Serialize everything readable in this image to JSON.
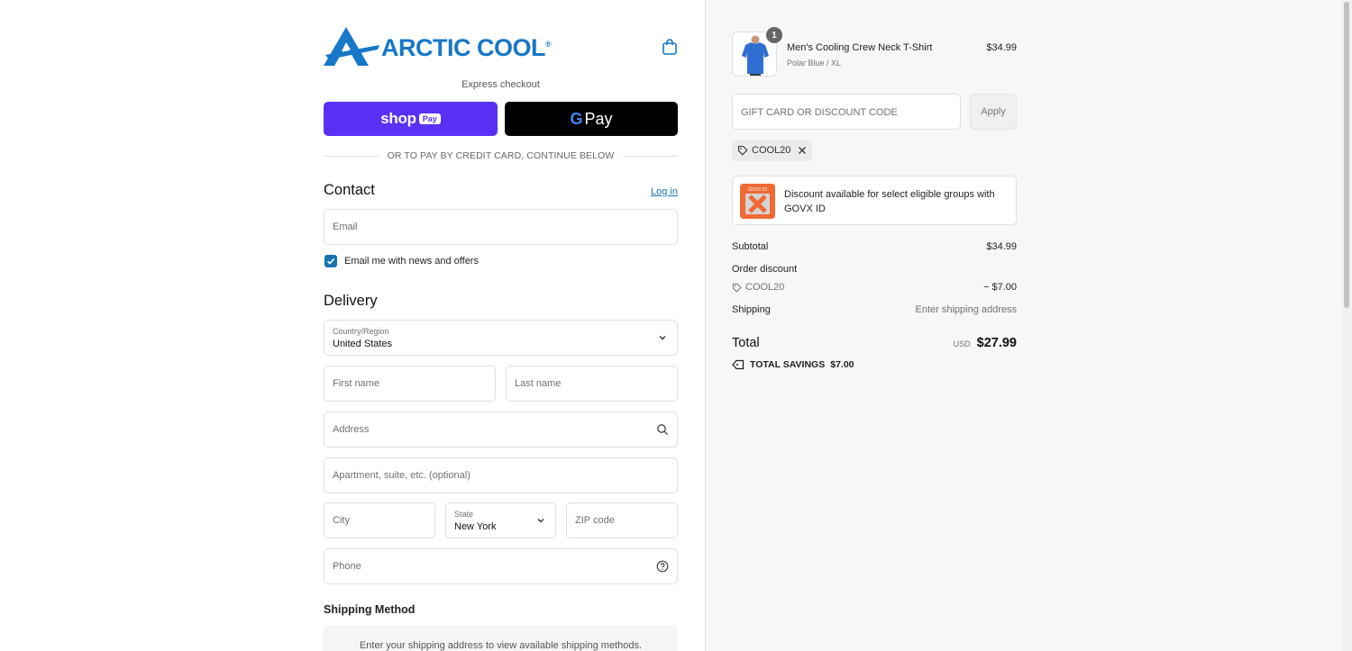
{
  "brand": {
    "name": "ARCTIC COOL",
    "reg": "®",
    "color": "#1777c8"
  },
  "express": {
    "label": "Express checkout",
    "shop_pay": {
      "shop": "shop",
      "pay": "Pay"
    },
    "gpay": {
      "g": "G",
      "pay": "Pay"
    }
  },
  "divider_text": "OR TO PAY BY CREDIT CARD, CONTINUE BELOW",
  "contact": {
    "title": "Contact",
    "login_label": "Log in",
    "email_placeholder": "Email",
    "newsletter_label": "Email me with news and offers",
    "newsletter_checked": true
  },
  "delivery": {
    "title": "Delivery",
    "country_label": "Country/Region",
    "country_value": "United States",
    "first_name_placeholder": "First name",
    "last_name_placeholder": "Last name",
    "address_placeholder": "Address",
    "apartment_placeholder": "Apartment, suite, etc. (optional)",
    "city_placeholder": "City",
    "state_label": "State",
    "state_value": "New York",
    "zip_placeholder": "ZIP code",
    "phone_placeholder": "Phone"
  },
  "shipping_method": {
    "title": "Shipping Method",
    "empty_text": "Enter your shipping address to view available shipping methods."
  },
  "cart": {
    "item": {
      "quantity": "1",
      "name": "Men's Cooling Crew Neck T-Shirt",
      "variant": "Polar Blue / XL",
      "price": "$34.99"
    },
    "discount_placeholder": "GIFT CARD OR DISCOUNT CODE",
    "apply_label": "Apply",
    "applied_code": "COOL20",
    "govx_logo_text": "GOVX ID",
    "govx_text": "Discount available for select eligible groups with GOVX ID"
  },
  "summary": {
    "subtotal_label": "Subtotal",
    "subtotal_value": "$34.99",
    "order_discount_label": "Order discount",
    "discount_code": "COOL20",
    "discount_value": "− $7.00",
    "shipping_label": "Shipping",
    "shipping_value": "Enter shipping address",
    "total_label": "Total",
    "total_currency": "USD",
    "total_value": "$27.99",
    "savings_label": "TOTAL SAVINGS",
    "savings_value": "$7.00"
  }
}
